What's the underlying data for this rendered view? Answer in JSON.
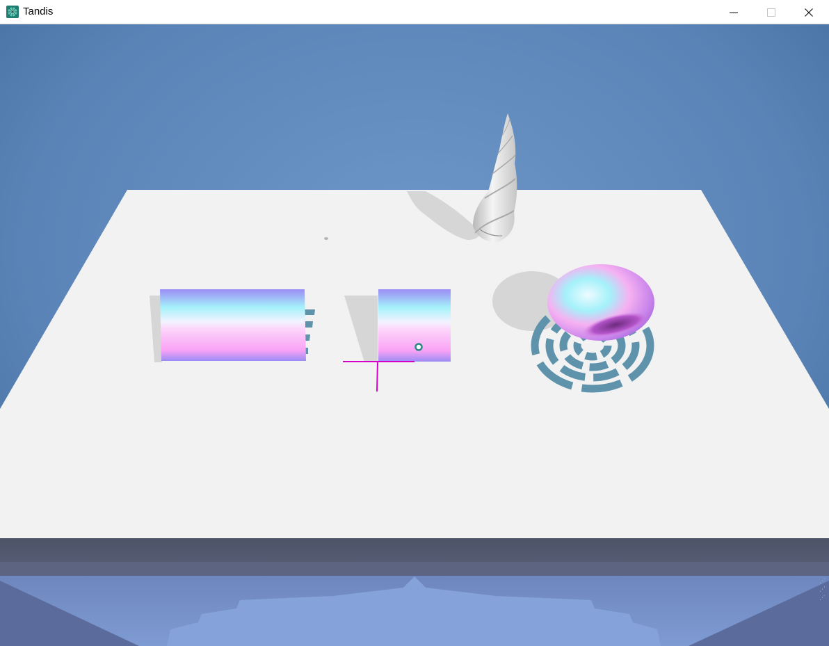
{
  "window": {
    "title": "Tandis",
    "icons": {
      "app": "tandis-app-icon",
      "minimize": "minimize-icon",
      "maximize": "maximize-icon",
      "close": "close-icon"
    }
  },
  "scene": {
    "colors": {
      "sky_top": "#3d6696",
      "sky_mid": "#6d97c8",
      "table_top": "#f2f2f2",
      "shadow": "#d6d6d6",
      "table_edge": "#545a6e",
      "reflection": "#7e99d0",
      "gradient_purple": "#9b8cf5",
      "gradient_cyan": "#a4f1fa",
      "gradient_pink": "#f9a2f5",
      "checker": "#5f93ab",
      "axis_marker": "#d400c8",
      "handle": "#2b8a86",
      "horn": "#e8e8e8",
      "ellipsoid_light": "#ecfbff",
      "ellipsoid_dark": "#a464df"
    },
    "objects": [
      {
        "name": "gradient-cylinder-long",
        "material": "gradient"
      },
      {
        "name": "gradient-cylinder-short",
        "material": "gradient"
      },
      {
        "name": "twisted-horn",
        "material": "matte-white"
      },
      {
        "name": "gradient-ellipsoid",
        "material": "gradient"
      },
      {
        "name": "checkered-ring-pattern",
        "material": "checker"
      }
    ]
  }
}
